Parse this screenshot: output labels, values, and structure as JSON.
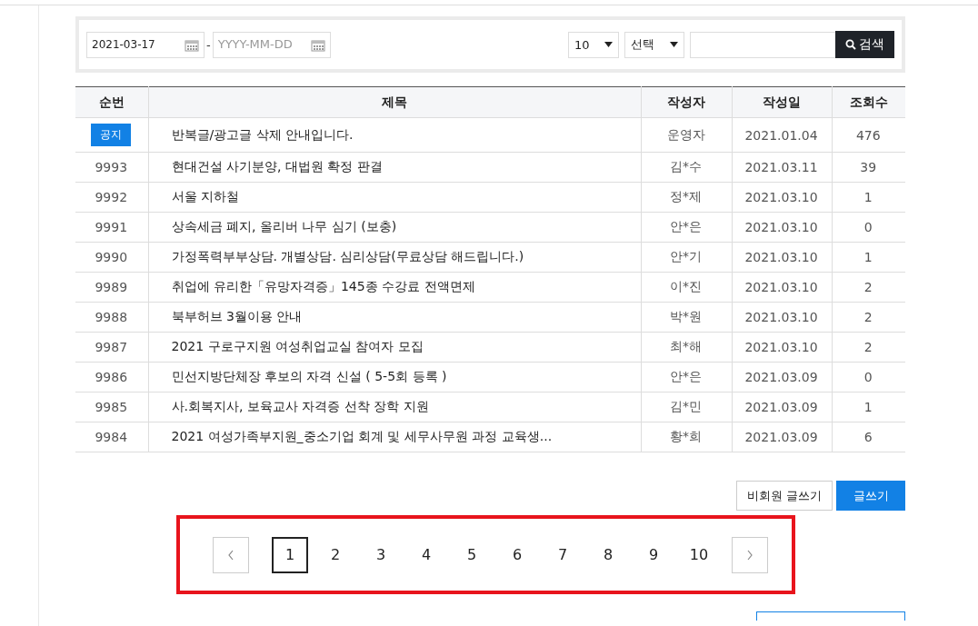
{
  "filter": {
    "date_from": {
      "value": "2021-03-17"
    },
    "separator": "-",
    "date_to": {
      "placeholder": "YYYY-MM-DD"
    },
    "page_size": {
      "value": "10"
    },
    "category": {
      "value": "선택"
    },
    "search_button": "검색"
  },
  "table": {
    "columns": [
      "순번",
      "제목",
      "작성자",
      "작성일",
      "조회수"
    ],
    "rows": [
      {
        "kind": "notice",
        "number": "공지",
        "title": "반복글/광고글 삭제 안내입니다.",
        "author": "운영자",
        "date": "2021.01.04",
        "views": "476"
      },
      {
        "kind": "post",
        "number": "9993",
        "title": "현대건설 사기분양, 대법원 확정 판결",
        "author": "김*수",
        "date": "2021.03.11",
        "views": "39"
      },
      {
        "kind": "post",
        "number": "9992",
        "title": "서울 지하철",
        "author": "정*제",
        "date": "2021.03.10",
        "views": "1"
      },
      {
        "kind": "post",
        "number": "9991",
        "title": "상속세금 폐지, 올리버 나무 심기 (보충)",
        "author": "안*은",
        "date": "2021.03.10",
        "views": "0"
      },
      {
        "kind": "post",
        "number": "9990",
        "title": "가정폭력부부상담. 개별상담. 심리상담(무료상담 해드립니다.)",
        "author": "안*기",
        "date": "2021.03.10",
        "views": "1"
      },
      {
        "kind": "post",
        "number": "9989",
        "title": "취업에 유리한「유망자격증」145종 수강료 전액면제",
        "author": "이*진",
        "date": "2021.03.10",
        "views": "2"
      },
      {
        "kind": "post",
        "number": "9988",
        "title": "북부허브 3월이용 안내",
        "author": "박*원",
        "date": "2021.03.10",
        "views": "2"
      },
      {
        "kind": "post",
        "number": "9987",
        "title": "2021 구로구지원 여성취업교실 참여자 모집",
        "author": "최*해",
        "date": "2021.03.10",
        "views": "2"
      },
      {
        "kind": "post",
        "number": "9986",
        "title": "민선지방단체장 후보의 자격 신설 ( 5-5회 등록 )",
        "author": "안*은",
        "date": "2021.03.09",
        "views": "0"
      },
      {
        "kind": "post",
        "number": "9985",
        "title": "사.회복지사, 보육교사 자격증 선착 장학 지원",
        "author": "김*민",
        "date": "2021.03.09",
        "views": "1"
      },
      {
        "kind": "post",
        "number": "9984",
        "title": "2021 여성가족부지원_중소기업 회계 및 세무사무원 과정 교육생...",
        "author": "황*희",
        "date": "2021.03.09",
        "views": "6"
      }
    ]
  },
  "actions": [
    "비회원 글쓰기",
    "글쓰기"
  ],
  "pagination": {
    "highlighted": true,
    "pages": [
      {
        "label": "1",
        "selected": true
      },
      {
        "label": "2",
        "selected": false
      },
      {
        "label": "3",
        "selected": false
      },
      {
        "label": "4",
        "selected": false
      },
      {
        "label": "5",
        "selected": false
      },
      {
        "label": "6",
        "selected": false
      },
      {
        "label": "7",
        "selected": false
      },
      {
        "label": "8",
        "selected": false
      },
      {
        "label": "9",
        "selected": false
      },
      {
        "label": "10",
        "selected": false
      }
    ]
  }
}
